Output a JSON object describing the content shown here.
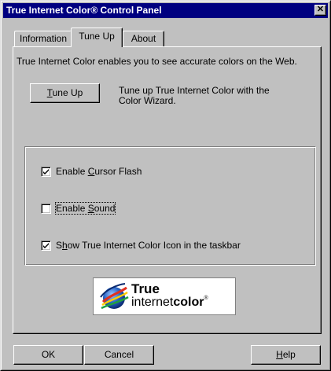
{
  "window": {
    "title": "True Internet Color® Control Panel",
    "close_glyph": "✕"
  },
  "tabs": [
    {
      "label": "Information",
      "active": false
    },
    {
      "label": "Tune Up",
      "active": true
    },
    {
      "label": "About",
      "active": false
    }
  ],
  "tuneup": {
    "intro": "True Internet Color enables you to see accurate colors on the Web.",
    "button_label_pre": "",
    "button_label_acc": "T",
    "button_label_post": "une Up",
    "description": "Tune up True Internet Color with the Color Wizard."
  },
  "options": [
    {
      "pre": "Enable ",
      "acc": "C",
      "post": "ursor Flash",
      "checked": true
    },
    {
      "pre": "Enable ",
      "acc": "S",
      "post": "ound",
      "checked": false
    },
    {
      "pre": "S",
      "acc": "h",
      "post": "ow True Internet Color Icon in the taskbar",
      "checked": true
    }
  ],
  "logo": {
    "line1": "True",
    "line2_normal": "internet",
    "line2_bold": "color",
    "reg_mark": "®"
  },
  "footer": {
    "ok_label": "OK",
    "cancel_label": "Cancel",
    "help_pre": "",
    "help_acc": "H",
    "help_post": "elp"
  },
  "colors": {
    "titlebar": "#000080",
    "face": "#c0c0c0"
  }
}
